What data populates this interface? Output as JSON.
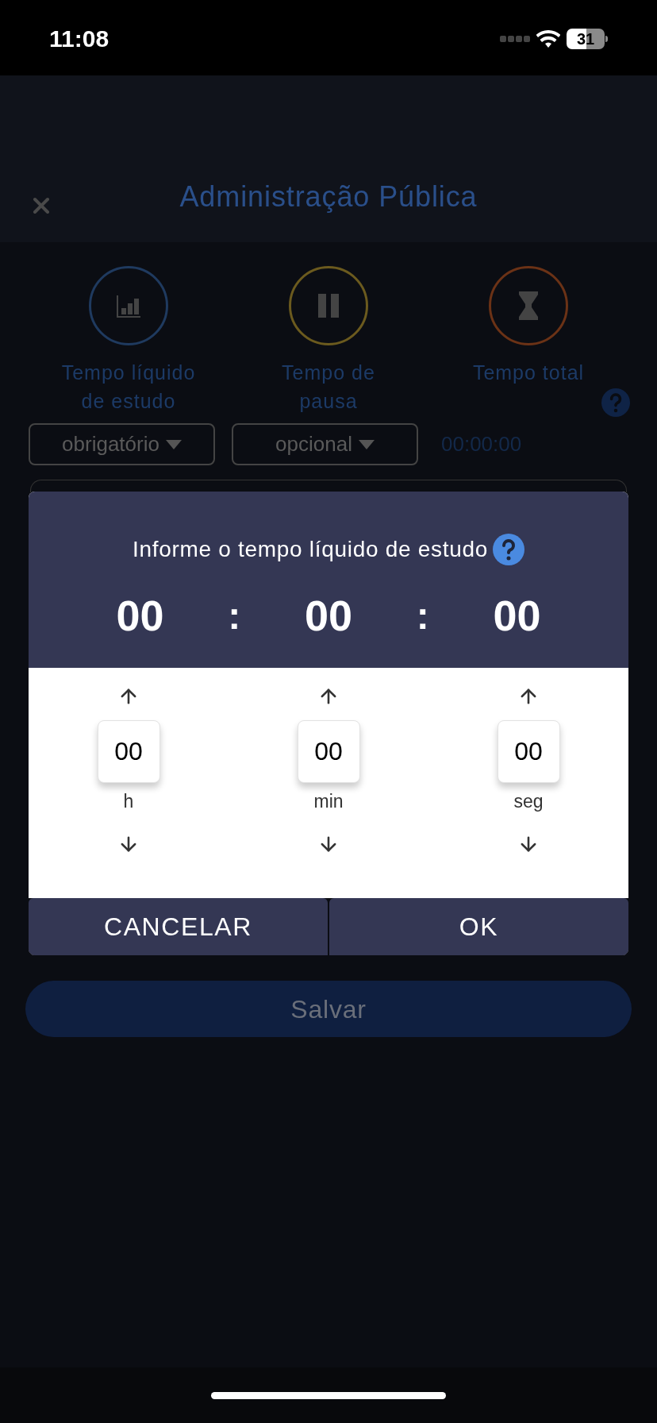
{
  "status_bar": {
    "time": "11:08",
    "battery": "31"
  },
  "header": {
    "title": "Administração Pública"
  },
  "stats": [
    {
      "kind": "study",
      "label": "Tempo líquido de estudo",
      "color": "#1f3a5f"
    },
    {
      "kind": "pause",
      "label": "Tempo de pausa",
      "color": "#6b5a1e"
    },
    {
      "kind": "total",
      "label": "Tempo total",
      "color": "#6b3216"
    }
  ],
  "selectors": [
    {
      "value": "obrigatório"
    },
    {
      "value": "opcional"
    }
  ],
  "total_time": "00:00:00",
  "dialog": {
    "title": "Informe o tempo líquido de estudo",
    "display": [
      "00",
      "00",
      "00"
    ],
    "separator": ":",
    "fields": [
      {
        "value": "00",
        "unit": "h"
      },
      {
        "value": "00",
        "unit": "min"
      },
      {
        "value": "00",
        "unit": "seg"
      }
    ],
    "buttons": [
      "CANCELAR",
      "OK"
    ]
  },
  "save_button": "Salvar"
}
